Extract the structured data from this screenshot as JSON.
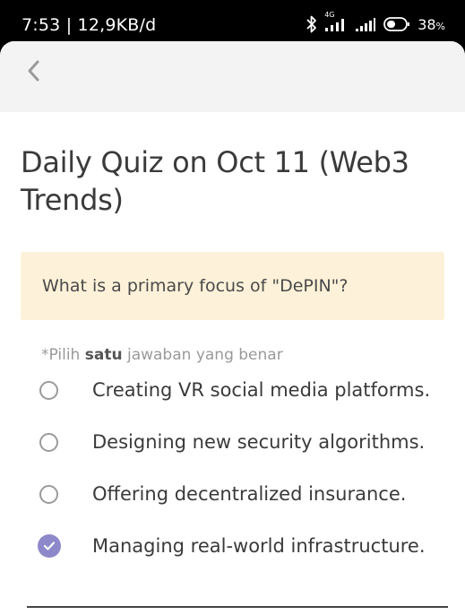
{
  "status_bar": {
    "time_speed": "7:53 | 12,9KB/d",
    "network_label": "4G",
    "battery_percent": "38",
    "battery_unit": "%",
    "icons": [
      "bluetooth-icon",
      "signal-icon",
      "signal-icon",
      "battery-icon"
    ]
  },
  "header": {
    "back_icon": "chevron-left-icon"
  },
  "quiz": {
    "title": "Daily Quiz on Oct 11 (Web3 Trends)",
    "question": "What is a primary focus of \"DePIN\"?",
    "instruction_prefix": "*Pilih ",
    "instruction_bold": "satu",
    "instruction_suffix": " jawaban yang benar",
    "options": [
      {
        "label": "Creating VR social media platforms.",
        "selected": false
      },
      {
        "label": "Designing new security algorithms.",
        "selected": false
      },
      {
        "label": "Offering decentralized insurance.",
        "selected": false
      },
      {
        "label": "Managing real-world infrastructure.",
        "selected": true
      }
    ]
  },
  "colors": {
    "question_bg": "#fdf2d9",
    "selected_accent": "#8c88c9",
    "header_bg": "#f3f3f3"
  }
}
